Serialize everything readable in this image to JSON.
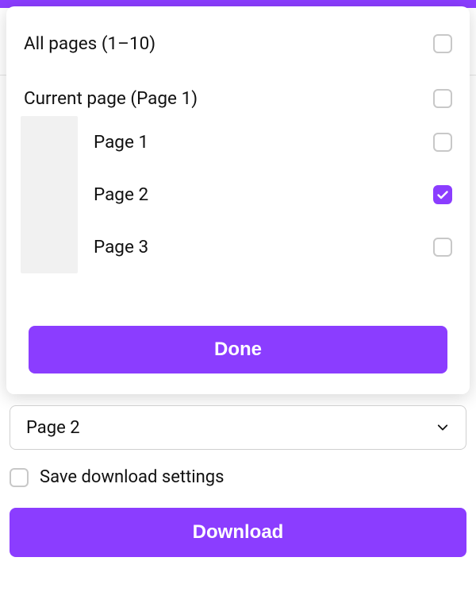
{
  "colors": {
    "accent": "#8b3dff"
  },
  "dropdown": {
    "all_pages_label": "All pages (1–10)",
    "current_page_label": "Current page (Page 1)",
    "pages": [
      {
        "label": "Page 1",
        "checked": false
      },
      {
        "label": "Page 2",
        "checked": true
      },
      {
        "label": "Page 3",
        "checked": false
      }
    ],
    "done_label": "Done"
  },
  "select": {
    "value": "Page 2"
  },
  "save_settings_label": "Save download settings",
  "download_label": "Download"
}
